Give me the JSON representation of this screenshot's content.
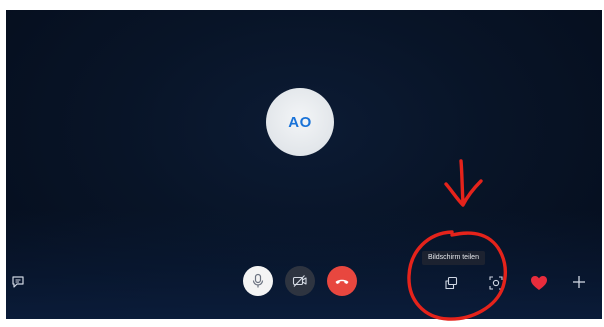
{
  "call": {
    "avatar_initials": "AO",
    "share_screen_tooltip": "Bildschirm teilen"
  },
  "controls": {
    "left": [
      {
        "icon": "chat-icon"
      }
    ],
    "center": [
      {
        "icon": "microphone-icon",
        "state": "on"
      },
      {
        "icon": "camera-off-icon",
        "state": "off"
      },
      {
        "icon": "end-call-icon"
      }
    ],
    "right": [
      {
        "icon": "share-screen-icon"
      },
      {
        "icon": "reaction-icon"
      },
      {
        "icon": "heart-icon"
      },
      {
        "icon": "plus-icon"
      }
    ]
  },
  "colors": {
    "background": "#081427",
    "accent_blue": "#1a73d8",
    "end_call_red": "#e8473f",
    "annotation_red": "#e5231b",
    "heart_red": "#e82c3c"
  },
  "annotation": {
    "shapes": [
      "red-arrow",
      "red-circle"
    ],
    "target": "share-screen-button"
  }
}
